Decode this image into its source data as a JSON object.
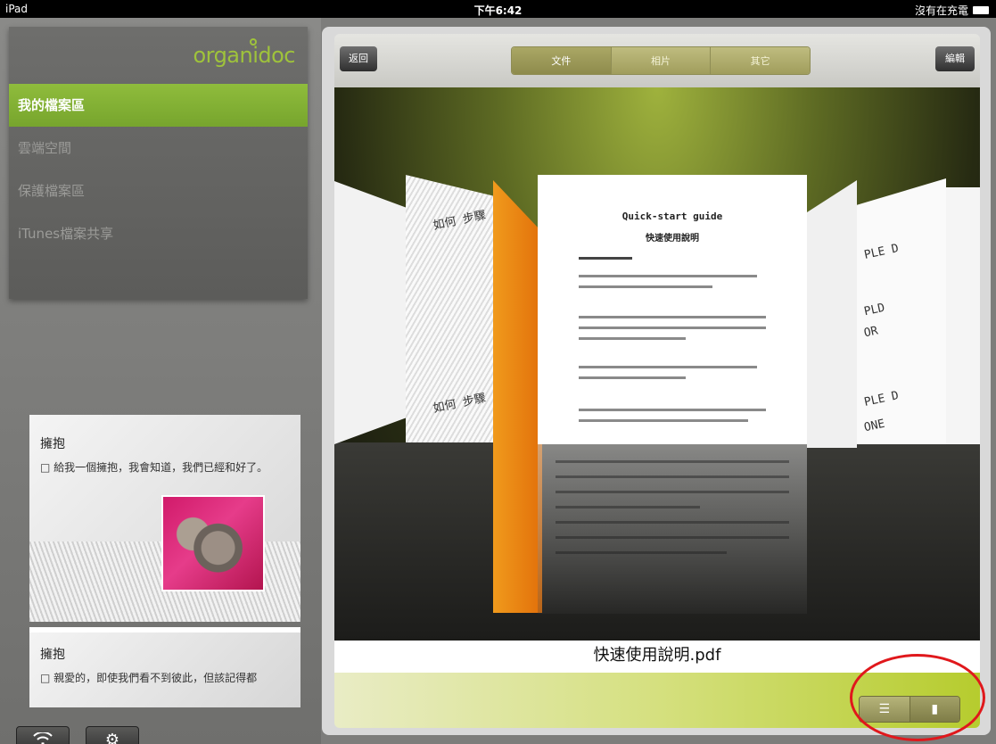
{
  "status_bar": {
    "device": "iPad",
    "time": "下午6:42",
    "charging": "沒有在充電"
  },
  "sidebar": {
    "logo": "organidoc",
    "items": [
      {
        "label": "我的檔案區",
        "active": true
      },
      {
        "label": "雲端空間",
        "active": false
      },
      {
        "label": "保護檔案區",
        "active": false
      },
      {
        "label": "iTunes檔案共享",
        "active": false
      }
    ],
    "preview1": {
      "heading": "擁抱",
      "bullet": "□ 給我一個擁抱，我會知道，我們已經和好了。"
    },
    "preview2": {
      "heading": "擁抱",
      "bullet": "□ 親愛的，即使我們看不到彼此，但該記得都"
    },
    "wifi_button": "wifi-icon",
    "settings_button": "gear-icon"
  },
  "toolbar": {
    "back_label": "返回",
    "tabs": [
      {
        "label": "文件",
        "active": true
      },
      {
        "label": "相片",
        "active": false
      },
      {
        "label": "其它",
        "active": false
      }
    ],
    "edit_label": "編輯"
  },
  "document": {
    "title": "Quick-start guide",
    "subtitle": "快速使用說明",
    "side_texts": [
      "如何 步驟",
      "如何 步驟",
      "PLE D",
      "PLD",
      "OR",
      "PLE D",
      "ONE"
    ]
  },
  "file_name": "快速使用說明.pdf",
  "view_mode": {
    "options": [
      "list-icon",
      "coverflow-icon"
    ],
    "selected": "coverflow-icon"
  },
  "colors": {
    "accent": "#8fbc3c",
    "highlight_ring": "#e0181c",
    "orange_doc": "#e2700a"
  }
}
